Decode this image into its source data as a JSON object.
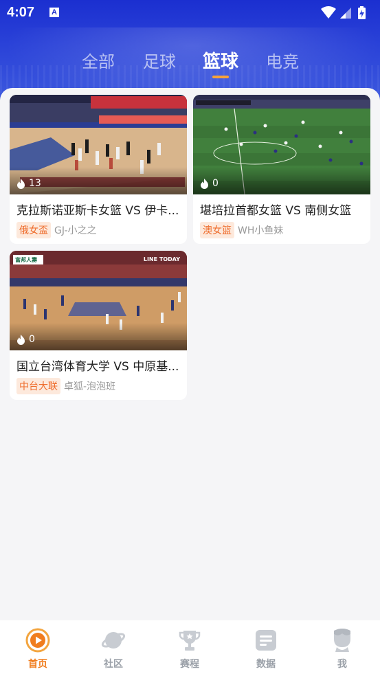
{
  "status_bar": {
    "time": "4:07",
    "notification_glyph": "A"
  },
  "tabs": [
    {
      "label": "全部",
      "active": false
    },
    {
      "label": "足球",
      "active": false
    },
    {
      "label": "篮球",
      "active": true
    },
    {
      "label": "电竞",
      "active": false
    }
  ],
  "videos": [
    {
      "title": "克拉斯诺亚斯卡女篮 VS 伊卡...",
      "league": "俄女盃",
      "author": "GJ-小之之",
      "views": "13"
    },
    {
      "title": "堪培拉首都女篮 VS 南侧女篮",
      "league": "澳女篮",
      "author": "WH小鱼妹",
      "views": "0"
    },
    {
      "title": "国立台湾体育大学 VS 中原基...",
      "league": "中台大联",
      "author": "卓狐-泡泡班",
      "views": "0"
    }
  ],
  "thumb_overlays": {
    "video3_logo": "富邦人壽",
    "video3_broadcaster": "LINE TODAY"
  },
  "bottom_nav": [
    {
      "label": "首页",
      "icon": "play-circle-icon",
      "active": true
    },
    {
      "label": "社区",
      "icon": "planet-icon",
      "active": false
    },
    {
      "label": "赛程",
      "icon": "trophy-icon",
      "active": false
    },
    {
      "label": "数据",
      "icon": "data-list-icon",
      "active": false
    },
    {
      "label": "我",
      "icon": "user-avatar-icon",
      "active": false
    }
  ],
  "colors": {
    "header_blue": "#2438d6",
    "accent_orange": "#f07d1e",
    "tag_bg": "#fde9dc"
  }
}
